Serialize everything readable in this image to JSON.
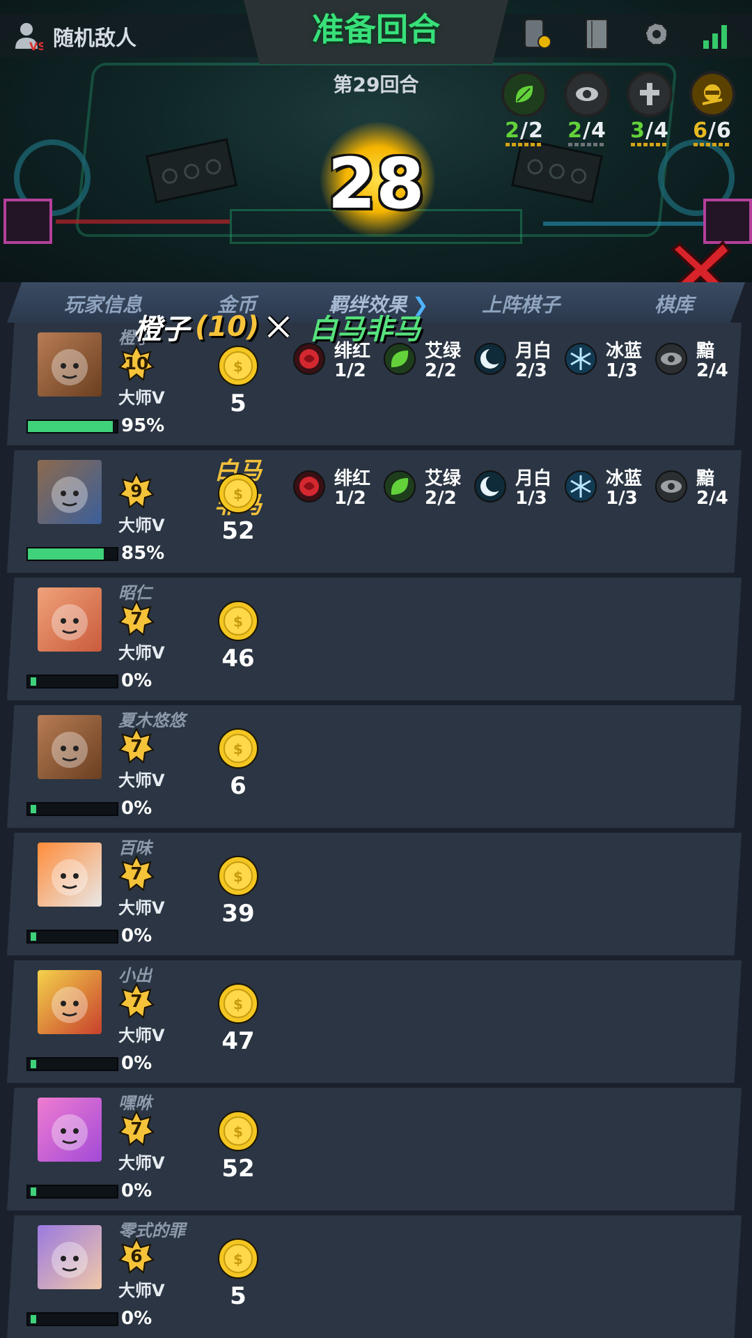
{
  "top": {
    "random_enemy_label": "随机敌人",
    "phase_title": "准备回合",
    "round_label": "第29回合",
    "countdown": "28",
    "traits": [
      {
        "icon": "leaf-icon",
        "color": "#63d23a",
        "active": "2",
        "total": "/2"
      },
      {
        "icon": "eye-icon",
        "color": "#bfc4c8",
        "active": "2",
        "total": "/4"
      },
      {
        "icon": "cross-icon",
        "color": "#bfc4c8",
        "active": "3",
        "total": "/4"
      },
      {
        "icon": "ninja-icon",
        "color": "#e7b922",
        "active": "6",
        "total": "/6"
      }
    ]
  },
  "header": {
    "player_info": "玩家信息",
    "gold": "金币",
    "synergy": "羁绊效果",
    "deployed": "上阵棋子",
    "bench": "棋库"
  },
  "battle": {
    "player_a": "橙子",
    "player_a_level": "(10)",
    "player_b": "白马非马"
  },
  "players": [
    {
      "name": "橙子",
      "level": "10",
      "rank": "大师V",
      "xp": "95%",
      "xp_fill": 95,
      "gold": "5",
      "name_gold": false,
      "synergies": [
        {
          "icon": "rose-icon",
          "name": "绯红",
          "count": "1/2"
        },
        {
          "icon": "leaf-icon",
          "name": "艾绿",
          "count": "2/2"
        },
        {
          "icon": "moon-icon",
          "name": "月白",
          "count": "2/3"
        },
        {
          "icon": "snowflake-icon",
          "name": "冰蓝",
          "count": "1/3"
        },
        {
          "icon": "eye-icon",
          "name": "黯",
          "count": "2/4"
        }
      ]
    },
    {
      "name": "白马非马",
      "level": "9",
      "rank": "大师V",
      "xp": "85%",
      "xp_fill": 85,
      "gold": "52",
      "name_gold": true,
      "synergies": [
        {
          "icon": "rose-icon",
          "name": "绯红",
          "count": "1/2"
        },
        {
          "icon": "leaf-icon",
          "name": "艾绿",
          "count": "2/2"
        },
        {
          "icon": "moon-icon",
          "name": "月白",
          "count": "1/3"
        },
        {
          "icon": "snowflake-icon",
          "name": "冰蓝",
          "count": "1/3"
        },
        {
          "icon": "eye-icon",
          "name": "黯",
          "count": "2/4"
        }
      ]
    },
    {
      "name": "昭仁",
      "level": "7",
      "rank": "大师V",
      "xp": "0%",
      "xp_fill": 0,
      "gold": "46",
      "name_gold": false,
      "synergies": []
    },
    {
      "name": "夏木悠悠",
      "level": "7",
      "rank": "大师V",
      "xp": "0%",
      "xp_fill": 0,
      "gold": "6",
      "name_gold": false,
      "synergies": []
    },
    {
      "name": "百味",
      "level": "7",
      "rank": "大师V",
      "xp": "0%",
      "xp_fill": 0,
      "gold": "39",
      "name_gold": false,
      "synergies": []
    },
    {
      "name": "小出",
      "level": "7",
      "rank": "大师V",
      "xp": "0%",
      "xp_fill": 0,
      "gold": "47",
      "name_gold": false,
      "synergies": []
    },
    {
      "name": "嘿咻",
      "level": "7",
      "rank": "大师V",
      "xp": "0%",
      "xp_fill": 0,
      "gold": "52",
      "name_gold": false,
      "synergies": []
    },
    {
      "name": "零式的罪",
      "level": "6",
      "rank": "大师V",
      "xp": "0%",
      "xp_fill": 0,
      "gold": "5",
      "name_gold": false,
      "synergies": []
    }
  ]
}
